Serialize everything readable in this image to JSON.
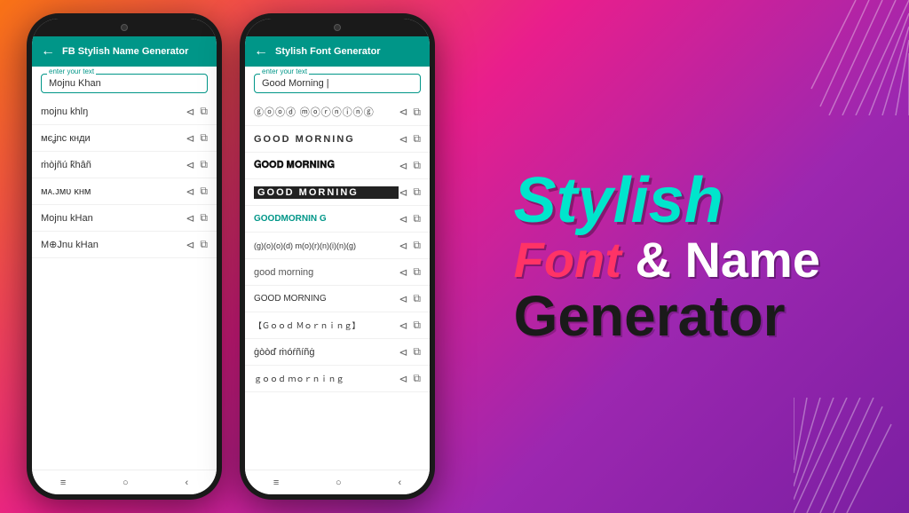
{
  "background": {
    "gradient": "135deg, #f97316, #e91e8c, #9c27b0"
  },
  "phone1": {
    "header": {
      "title": "FB Stylish Name Generator",
      "back_label": "←"
    },
    "input": {
      "label": "enter your text",
      "value": "Mojnu Khan"
    },
    "styles": [
      {
        "text": "mojnu khλŋ",
        "type": "special1"
      },
      {
        "text": "мєʝnu кнди",
        "type": "special2"
      },
      {
        "text": "ṁòjñú k̃hâñ",
        "type": "special3"
      },
      {
        "text": "ᴍᴀ.ᴊᴍᴜ ᴋʜᴍ",
        "type": "special4"
      },
      {
        "text": "Mojnu kHan",
        "type": "special5"
      },
      {
        "text": "M⊕Jnu kHan",
        "type": "special6"
      }
    ],
    "nav": [
      "≡",
      "○",
      "‹"
    ]
  },
  "phone2": {
    "header": {
      "title": "Stylish Font Generator",
      "back_label": "←"
    },
    "input": {
      "label": "enter your text",
      "value": "Good Morning |"
    },
    "styles": [
      {
        "text": "ⓖⓞⓞⓓ ⓜⓞⓡⓝⓘⓝⓖ",
        "type": "circle"
      },
      {
        "text": "GOOD MORNING",
        "type": "outlined"
      },
      {
        "text": "𝐆𝐎𝐎𝐃 𝐌𝐎𝐑𝐍𝐈𝐍𝐆",
        "type": "bold"
      },
      {
        "text": "GOOD MORNING",
        "type": "bold-outlined"
      },
      {
        "text": "GOODMORNIN G",
        "type": "teal"
      },
      {
        "text": "(g)(o)(o)(d) m(o)(r)(n)(i)(n)(g)",
        "type": "parens"
      },
      {
        "text": "good morning",
        "type": "italic"
      },
      {
        "text": "GOOD MORNING",
        "type": "caps"
      },
      {
        "text": "【Ｇｏｏｄ Ｍｏｒｎｉｎｇ】",
        "type": "brackets"
      },
      {
        "text": "ġòòď ṁóŕñíñġ",
        "type": "dots"
      },
      {
        "text": "ｇｏｏｄ ｍｏｒｎｉｎｇ",
        "type": "fullwidth"
      }
    ],
    "nav": [
      "≡",
      "○",
      "‹"
    ]
  },
  "brand": {
    "line1": "Stylish",
    "line2_part1": "Font",
    "line2_part2": "& Name",
    "line3": "Generator"
  },
  "actions": {
    "share_icon": "⊲",
    "copy_icon": "⧉"
  }
}
